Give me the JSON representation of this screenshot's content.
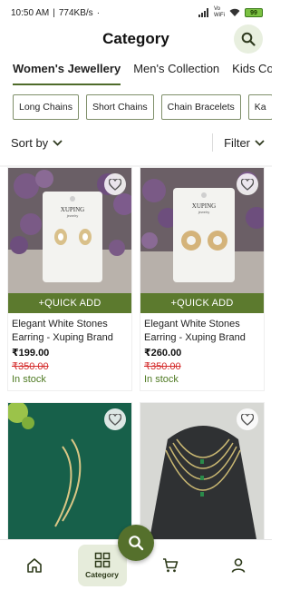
{
  "status_bar": {
    "time": "10:50 AM",
    "net_speed": "774KB/s",
    "vo_label": "Vo\nWiFi",
    "battery": "99"
  },
  "header": {
    "title": "Category"
  },
  "tabs": [
    {
      "label": "Women's Jewellery",
      "active": true
    },
    {
      "label": "Men's Collection",
      "active": false
    },
    {
      "label": "Kids Co",
      "active": false
    }
  ],
  "chips": [
    "Long Chains",
    "Short Chains",
    "Chain Bracelets",
    "Ka"
  ],
  "sort": {
    "label": "Sort by"
  },
  "filter": {
    "label": "Filter"
  },
  "quick_add_label": "+QUICK ADD",
  "products": [
    {
      "name": "Elegant White Stones Earring - Xuping Brand",
      "price": "₹199.00",
      "mrp": "₹350.00",
      "stock": "In stock",
      "card_brand": "XUPING",
      "card_sub": "jewelry"
    },
    {
      "name": "Elegant White Stones Earring - Xuping Brand",
      "price": "₹260.00",
      "mrp": "₹350.00",
      "stock": "In stock",
      "card_brand": "XUPING",
      "card_sub": "jewelry"
    },
    {
      "name": "",
      "price": "",
      "mrp": "",
      "stock": ""
    },
    {
      "name": "",
      "price": "",
      "mrp": "",
      "stock": ""
    }
  ],
  "bottom_nav": [
    {
      "icon": "home-icon",
      "label": ""
    },
    {
      "icon": "category-icon",
      "label": "Category",
      "active": true
    },
    {
      "icon": "cart-icon",
      "label": ""
    },
    {
      "icon": "profile-icon",
      "label": ""
    }
  ],
  "colors": {
    "accent": "#5c7a2e",
    "accent_light": "#e6ecdb",
    "mrp_red": "#d42b2b",
    "stock_green": "#4f7a23"
  }
}
